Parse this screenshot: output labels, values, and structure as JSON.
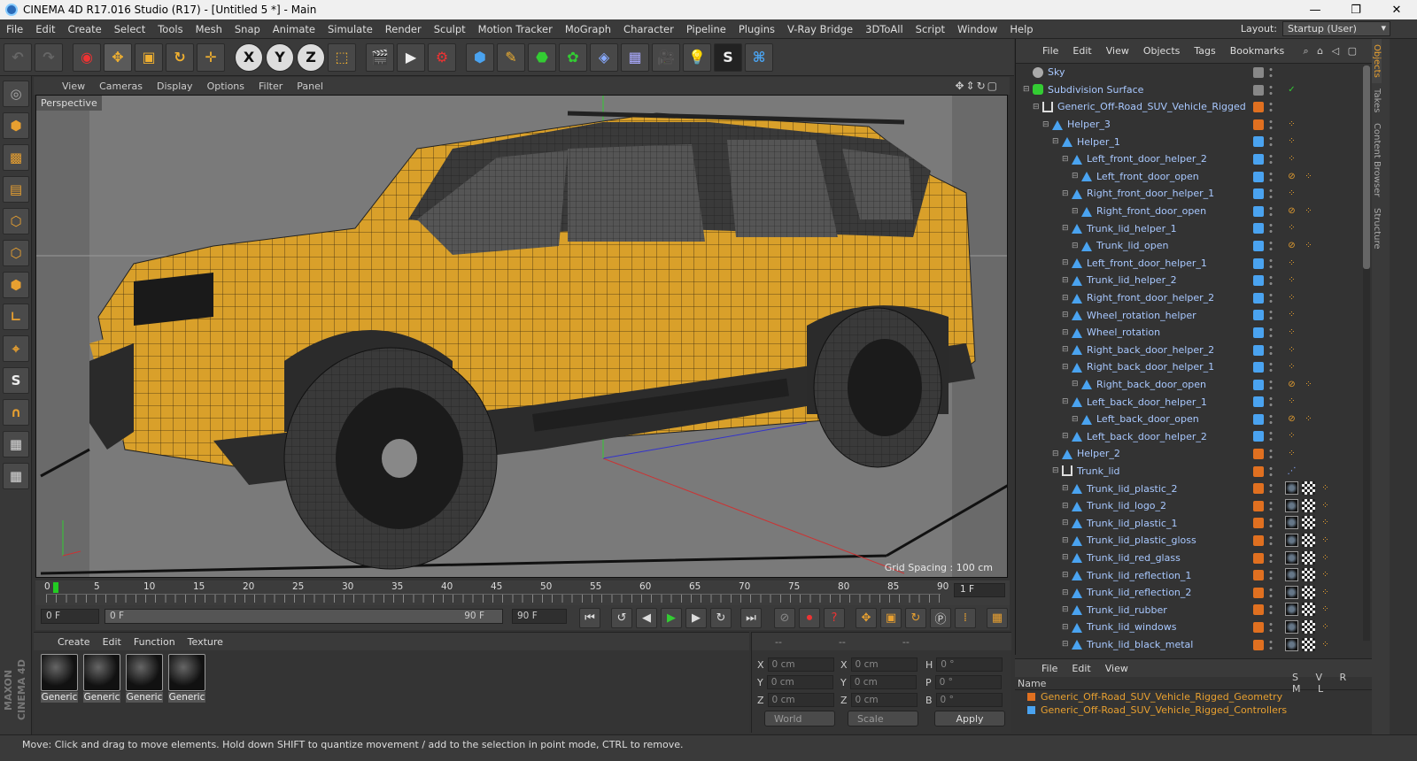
{
  "window": {
    "title": "CINEMA 4D R17.016 Studio (R17) - [Untitled 5 *] - Main",
    "min": "—",
    "max": "❐",
    "close": "✕"
  },
  "menu": [
    "File",
    "Edit",
    "Create",
    "Select",
    "Tools",
    "Mesh",
    "Snap",
    "Animate",
    "Simulate",
    "Render",
    "Sculpt",
    "Motion Tracker",
    "MoGraph",
    "Character",
    "Pipeline",
    "Plugins",
    "V-Ray Bridge",
    "3DToAll",
    "Script",
    "Window",
    "Help"
  ],
  "layout": {
    "label": "Layout:",
    "value": "Startup (User)"
  },
  "viewport": {
    "menu": [
      "View",
      "Cameras",
      "Display",
      "Options",
      "Filter",
      "Panel"
    ],
    "label": "Perspective",
    "grid_spacing": "Grid Spacing : 100 cm"
  },
  "timeline": {
    "labels": [
      "0",
      "5",
      "10",
      "15",
      "20",
      "25",
      "30",
      "35",
      "40",
      "45",
      "50",
      "55",
      "60",
      "65",
      "70",
      "75",
      "80",
      "85",
      "90"
    ],
    "current_frame": "1 F",
    "start": "0 F",
    "range_start": "0 F",
    "range_end": "90 F",
    "end": "90 F"
  },
  "materials": {
    "menu": [
      "Create",
      "Edit",
      "Function",
      "Texture"
    ],
    "items": [
      "Generic",
      "Generic",
      "Generic",
      "Generic"
    ]
  },
  "coords": {
    "headers": [
      "--",
      "--",
      "--"
    ],
    "rows": [
      {
        "a": "X",
        "v1": "0 cm",
        "b": "X",
        "v2": "0 cm",
        "c": "H",
        "v3": "0 °"
      },
      {
        "a": "Y",
        "v1": "0 cm",
        "b": "Y",
        "v2": "0 cm",
        "c": "P",
        "v3": "0 °"
      },
      {
        "a": "Z",
        "v1": "0 cm",
        "b": "Z",
        "v2": "0 cm",
        "c": "B",
        "v3": "0 °"
      }
    ],
    "mode": "World",
    "scale": "Scale",
    "apply": "Apply"
  },
  "objects": {
    "menu": [
      "File",
      "Edit",
      "View",
      "Objects",
      "Tags",
      "Bookmarks"
    ],
    "tree": [
      {
        "name": "Sky",
        "d": 0,
        "color": "#888",
        "kind": "sky"
      },
      {
        "name": "Subdivision Surface",
        "d": 0,
        "color": "#888",
        "kind": "sds"
      },
      {
        "name": "Generic_Off-Road_SUV_Vehicle_Rigged",
        "d": 1,
        "color": "#e07020",
        "kind": "null"
      },
      {
        "name": "Helper_3",
        "d": 2,
        "color": "#e07020",
        "kind": "tri"
      },
      {
        "name": "Helper_1",
        "d": 3,
        "color": "#4aa3f0",
        "kind": "tri"
      },
      {
        "name": "Left_front_door_helper_2",
        "d": 4,
        "color": "#4aa3f0",
        "kind": "tri"
      },
      {
        "name": "Left_front_door_open",
        "d": 5,
        "color": "#4aa3f0",
        "kind": "tri",
        "tag": "no"
      },
      {
        "name": "Right_front_door_helper_1",
        "d": 4,
        "color": "#4aa3f0",
        "kind": "tri"
      },
      {
        "name": "Right_front_door_open",
        "d": 5,
        "color": "#4aa3f0",
        "kind": "tri",
        "tag": "no"
      },
      {
        "name": "Trunk_lid_helper_1",
        "d": 4,
        "color": "#4aa3f0",
        "kind": "tri"
      },
      {
        "name": "Trunk_lid_open",
        "d": 5,
        "color": "#4aa3f0",
        "kind": "tri",
        "tag": "no"
      },
      {
        "name": "Left_front_door_helper_1",
        "d": 4,
        "color": "#4aa3f0",
        "kind": "tri"
      },
      {
        "name": "Trunk_lid_helper_2",
        "d": 4,
        "color": "#4aa3f0",
        "kind": "tri"
      },
      {
        "name": "Right_front_door_helper_2",
        "d": 4,
        "color": "#4aa3f0",
        "kind": "tri"
      },
      {
        "name": "Wheel_rotation_helper",
        "d": 4,
        "color": "#4aa3f0",
        "kind": "tri"
      },
      {
        "name": "Wheel_rotation",
        "d": 4,
        "color": "#4aa3f0",
        "kind": "tri"
      },
      {
        "name": "Right_back_door_helper_2",
        "d": 4,
        "color": "#4aa3f0",
        "kind": "tri"
      },
      {
        "name": "Right_back_door_helper_1",
        "d": 4,
        "color": "#4aa3f0",
        "kind": "tri"
      },
      {
        "name": "Right_back_door_open",
        "d": 5,
        "color": "#4aa3f0",
        "kind": "tri",
        "tag": "no"
      },
      {
        "name": "Left_back_door_helper_1",
        "d": 4,
        "color": "#4aa3f0",
        "kind": "tri"
      },
      {
        "name": "Left_back_door_open",
        "d": 5,
        "color": "#4aa3f0",
        "kind": "tri",
        "tag": "no"
      },
      {
        "name": "Left_back_door_helper_2",
        "d": 4,
        "color": "#4aa3f0",
        "kind": "tri"
      },
      {
        "name": "Helper_2",
        "d": 3,
        "color": "#e07020",
        "kind": "tri"
      },
      {
        "name": "Trunk_lid",
        "d": 3,
        "color": "#e07020",
        "kind": "null",
        "tag": "joint"
      },
      {
        "name": "Trunk_lid_plastic_2",
        "d": 4,
        "color": "#e07020",
        "kind": "tri",
        "tag": "mat"
      },
      {
        "name": "Trunk_lid_logo_2",
        "d": 4,
        "color": "#e07020",
        "kind": "tri",
        "tag": "mat"
      },
      {
        "name": "Trunk_lid_plastic_1",
        "d": 4,
        "color": "#e07020",
        "kind": "tri",
        "tag": "mat"
      },
      {
        "name": "Trunk_lid_plastic_gloss",
        "d": 4,
        "color": "#e07020",
        "kind": "tri",
        "tag": "mat"
      },
      {
        "name": "Trunk_lid_red_glass",
        "d": 4,
        "color": "#e07020",
        "kind": "tri",
        "tag": "mat"
      },
      {
        "name": "Trunk_lid_reflection_1",
        "d": 4,
        "color": "#e07020",
        "kind": "tri",
        "tag": "mat"
      },
      {
        "name": "Trunk_lid_reflection_2",
        "d": 4,
        "color": "#e07020",
        "kind": "tri",
        "tag": "mat"
      },
      {
        "name": "Trunk_lid_rubber",
        "d": 4,
        "color": "#e07020",
        "kind": "tri",
        "tag": "mat"
      },
      {
        "name": "Trunk_lid_windows",
        "d": 4,
        "color": "#e07020",
        "kind": "tri",
        "tag": "mat"
      },
      {
        "name": "Trunk_lid_black_metal",
        "d": 4,
        "color": "#e07020",
        "kind": "tri",
        "tag": "mat"
      }
    ]
  },
  "sidetabs": [
    "Objects",
    "Takes",
    "Content Browser",
    "Structure"
  ],
  "layers": {
    "menu": [
      "File",
      "Edit",
      "View"
    ],
    "col_name": "Name",
    "col_flags": "S V R M L",
    "rows": [
      {
        "name": "Generic_Off-Road_SUV_Vehicle_Rigged_Geometry",
        "color": "#e07020"
      },
      {
        "name": "Generic_Off-Road_SUV_Vehicle_Rigged_Controllers",
        "color": "#4aa3f0"
      }
    ]
  },
  "status": "Move: Click and drag to move elements. Hold down SHIFT to quantize movement / add to the selection in point mode, CTRL to remove.",
  "brand": "MAXON CINEMA 4D"
}
